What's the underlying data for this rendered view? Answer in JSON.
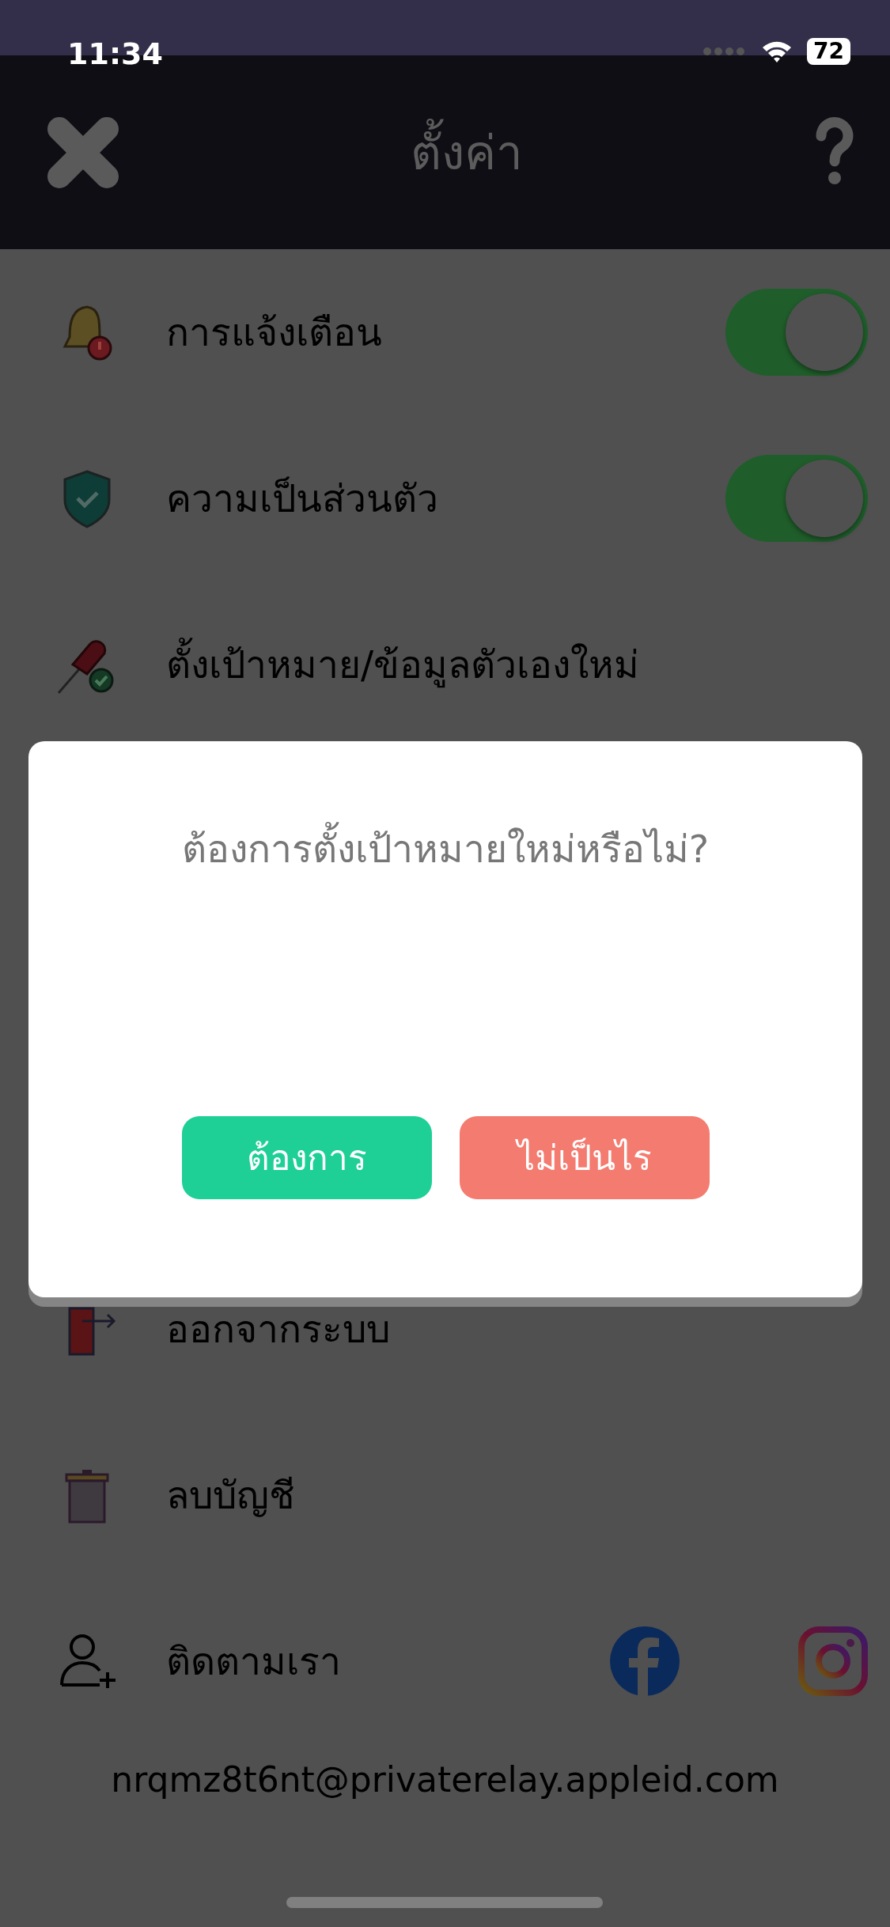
{
  "status_bar": {
    "time": "11:34",
    "battery": "72"
  },
  "header": {
    "title": "ตั้งค่า"
  },
  "settings": [
    {
      "kind": "toggle",
      "label": "การแจ้งเตือน",
      "on": true
    },
    {
      "kind": "toggle",
      "label": "ความเป็นส่วนตัว",
      "on": true
    },
    {
      "kind": "link",
      "label": "ตั้งเป้าหมาย/ข้อมูลตัวเองใหม่"
    },
    {
      "kind": "link",
      "label": "ออกจากระบบ"
    },
    {
      "kind": "link",
      "label": "ลบบัญชี"
    },
    {
      "kind": "follow",
      "label": "ติดตามเรา"
    }
  ],
  "email": "nrqmz8t6nt@privaterelay.appleid.com",
  "dialog": {
    "message": "ต้องการตั้งเป้าหมายใหม่หรือไม่?",
    "buttons": [
      {
        "label": "ต้องการ",
        "kind": "confirm"
      },
      {
        "label": "ไม่เป็นไร",
        "kind": "cancel"
      }
    ]
  }
}
